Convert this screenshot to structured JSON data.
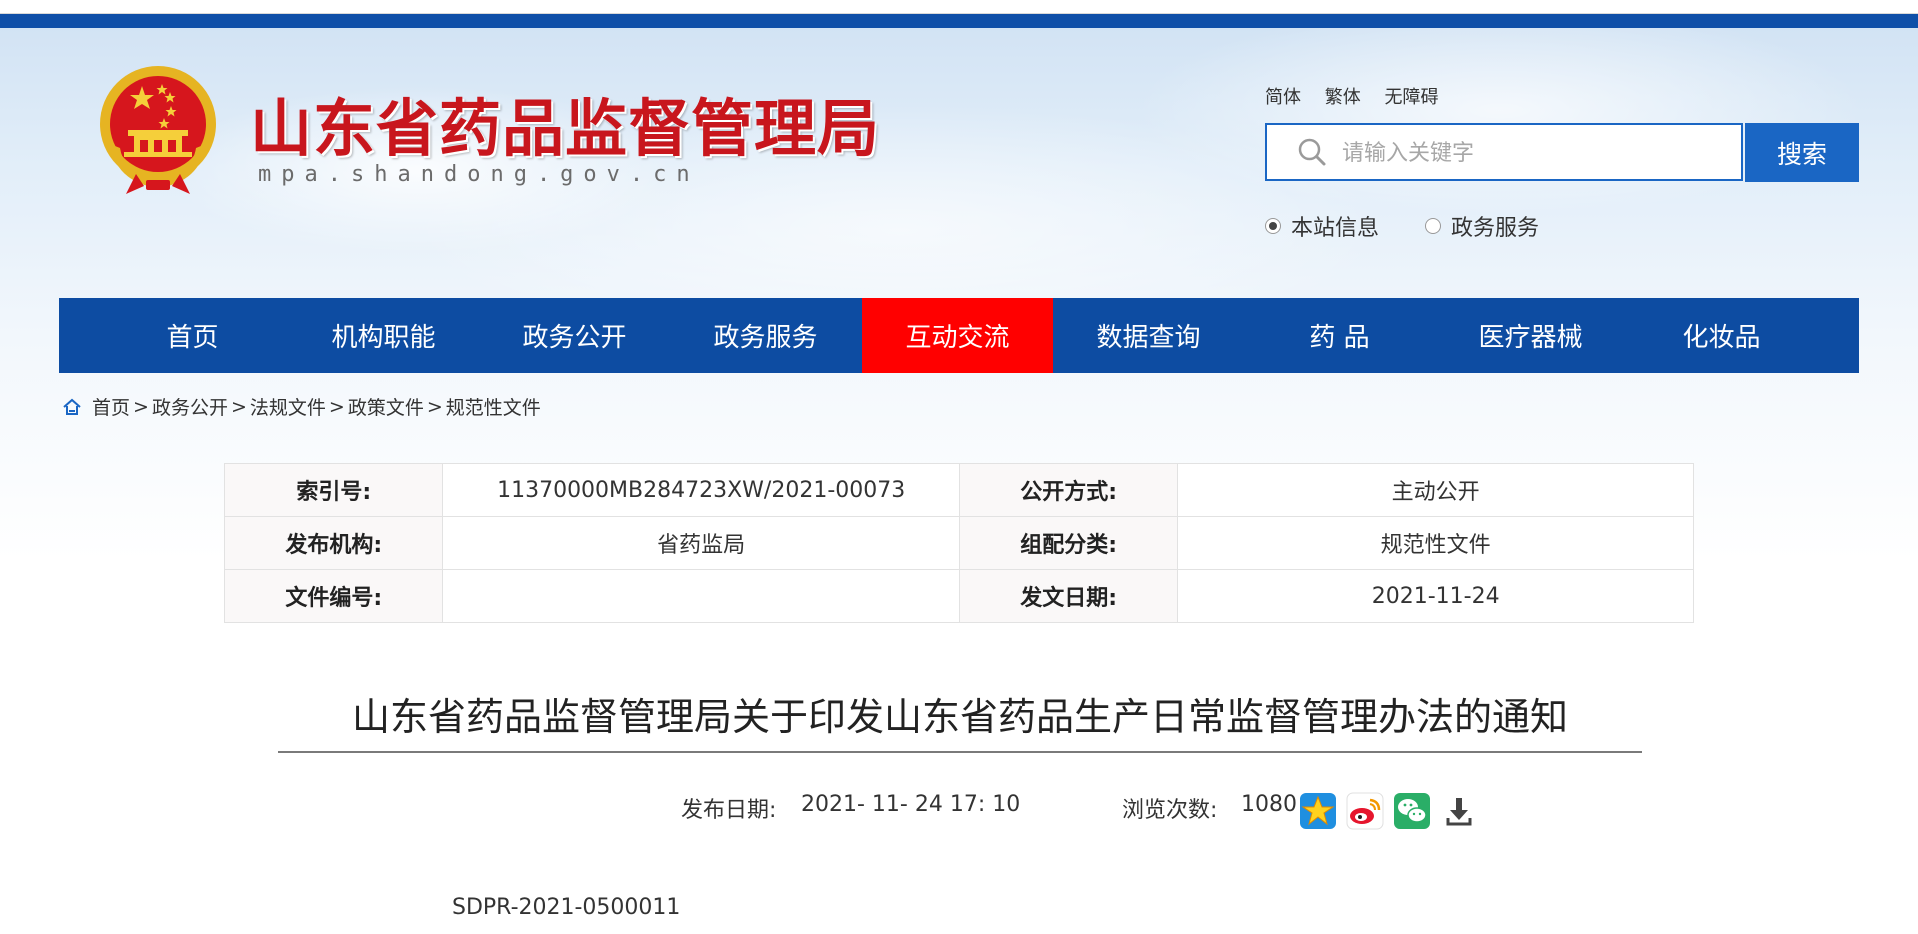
{
  "header": {
    "site_title": "山东省药品监督管理局",
    "site_domain": "mpa.shandong.gov.cn",
    "lang_links": [
      "简体",
      "繁体",
      "无障碍"
    ],
    "search": {
      "placeholder": "请输入关键字",
      "value": "",
      "button_label": "搜索",
      "scopes": [
        {
          "label": "本站信息",
          "checked": true
        },
        {
          "label": "政务服务",
          "checked": false
        }
      ]
    }
  },
  "nav": {
    "items": [
      {
        "label": "首页",
        "active": false
      },
      {
        "label": "机构职能",
        "active": false
      },
      {
        "label": "政务公开",
        "active": false
      },
      {
        "label": "政务服务",
        "active": false
      },
      {
        "label": "互动交流",
        "active": true
      },
      {
        "label": "数据查询",
        "active": false
      },
      {
        "label": "药 品",
        "active": false
      },
      {
        "label": "医疗器械",
        "active": false
      },
      {
        "label": "化妆品",
        "active": false
      }
    ],
    "active_color": "#ff0000",
    "bar_color": "#0d4ca2"
  },
  "breadcrumb": {
    "items": [
      "首页",
      "政务公开",
      "法规文件",
      "政策文件",
      "规范性文件"
    ],
    "separator": ">"
  },
  "info_table": {
    "rows": [
      {
        "label1": "索引号:",
        "value1": "11370000MB284723XW/2021-00073",
        "label2": "公开方式:",
        "value2": "主动公开"
      },
      {
        "label1": "发布机构:",
        "value1": "省药监局",
        "label2": "组配分类:",
        "value2": "规范性文件"
      },
      {
        "label1": "文件编号:",
        "value1": "",
        "label2": "发文日期:",
        "value2": "2021-11-24"
      }
    ]
  },
  "article": {
    "title": "山东省药品监督管理局关于印发山东省药品生产日常监督管理办法的通知",
    "publish_date_label": "发布日期:",
    "publish_date": "2021- 11- 24 17: 10",
    "views_label": "浏览次数:",
    "views": "1080",
    "share_icons": [
      "favorite-icon",
      "weibo-icon",
      "wechat-icon",
      "download-icon"
    ],
    "doc_code": "SDPR-2021-0500011"
  }
}
